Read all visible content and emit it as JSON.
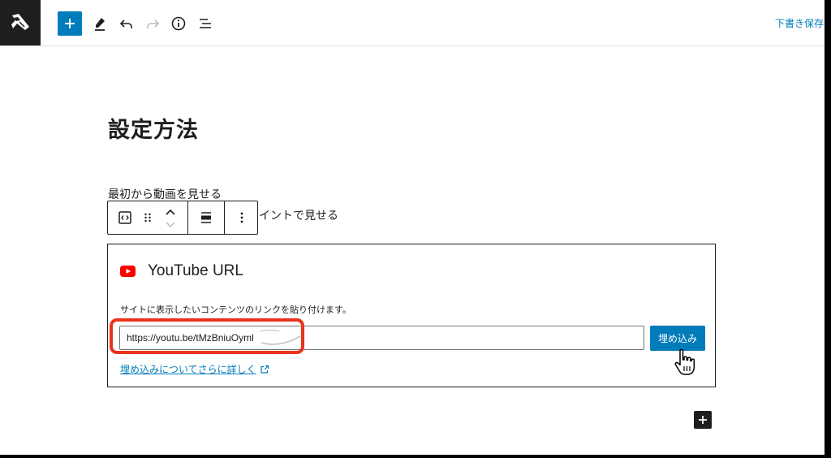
{
  "toolbar": {
    "save_draft_label": "下書き保存"
  },
  "editor": {
    "page_title": "設定方法",
    "paragraphs": [
      "最初から動画を見せる",
      "イントで見せる"
    ]
  },
  "embed": {
    "title": "YouTube URL",
    "description": "サイトに表示したいコンテンツのリンクを貼り付けます。",
    "url_value": "https://youtu.be/tMzBniuOyml",
    "button_label": "埋め込み",
    "learn_more_label": "埋め込みについてさらに詳しく"
  },
  "colors": {
    "accent": "#007cba",
    "highlight": "#e8341c",
    "youtube_red": "#ff0000",
    "dark": "#1e1e1e"
  },
  "icons": {
    "logo": "wordpress-logo-icon",
    "add": "plus-icon",
    "tools": "pencil-icon",
    "undo": "undo-icon",
    "redo": "redo-icon",
    "details": "info-icon",
    "outline": "list-view-icon",
    "block_type": "embed-code-icon",
    "drag": "drag-handle-icon",
    "move_up": "chevron-up-icon",
    "move_down": "chevron-down-icon",
    "align": "align-icon",
    "options": "more-vertical-icon",
    "youtube": "youtube-icon",
    "external": "external-link-icon"
  }
}
